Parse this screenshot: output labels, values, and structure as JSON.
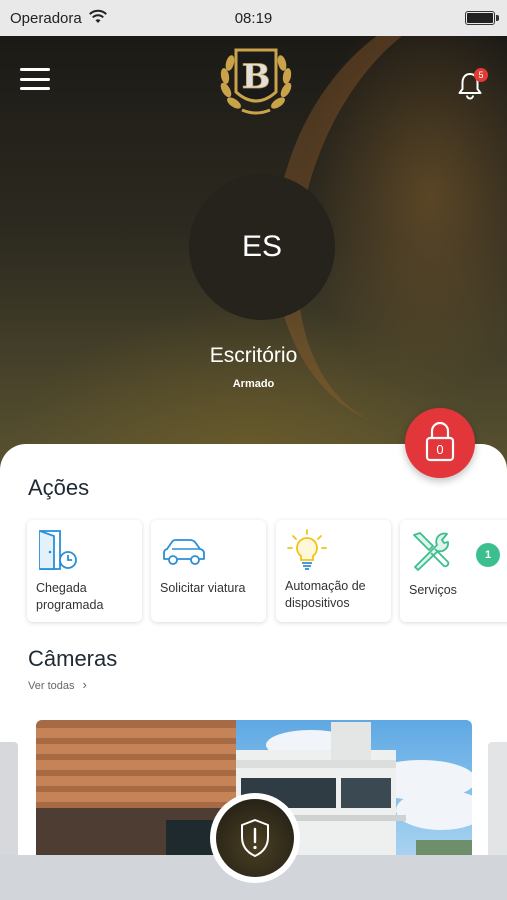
{
  "status_bar": {
    "carrier": "Operadora",
    "time": "08:19"
  },
  "header": {
    "notification_count": "5"
  },
  "site": {
    "initials": "ES",
    "name": "Escritório",
    "state": "Armado"
  },
  "lock_button": {
    "count": "0"
  },
  "actions": {
    "title": "Ações",
    "items": [
      {
        "label": "Chegada programada",
        "icon": "door-clock-icon"
      },
      {
        "label": "Solicitar viatura",
        "icon": "car-icon"
      },
      {
        "label": "Automação de dispositivos",
        "icon": "lightbulb-icon"
      },
      {
        "label": "Serviços",
        "icon": "tools-icon",
        "badge": "1"
      }
    ]
  },
  "cameras": {
    "title": "Câmeras",
    "see_all": "Ver todas"
  },
  "colors": {
    "accent_red": "#e2363a",
    "badge_green": "#3cbf8f",
    "icon_blue": "#2a8fd6",
    "icon_yellow": "#f2c21b"
  }
}
